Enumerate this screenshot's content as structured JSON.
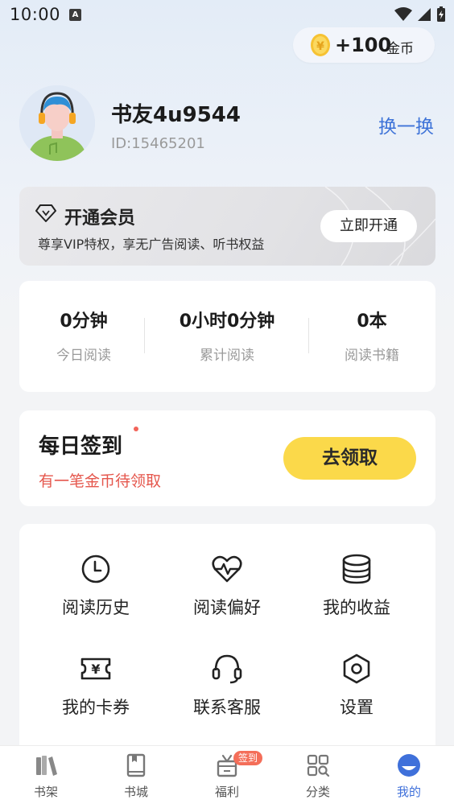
{
  "status_bar": {
    "time": "10:00",
    "notification_letter": "A"
  },
  "coins": {
    "amount": "+100",
    "label": "金币"
  },
  "profile": {
    "username": "书友4u9544",
    "user_id": "ID:15465201",
    "switch_label": "换一换"
  },
  "vip": {
    "title": "开通会员",
    "description": "尊享VIP特权，享无广告阅读、听书权益",
    "button_label": "立即开通"
  },
  "stats": [
    {
      "value": "0分钟",
      "label": "今日阅读"
    },
    {
      "value": "0小时0分钟",
      "label": "累计阅读"
    },
    {
      "value": "0本",
      "label": "阅读书籍"
    }
  ],
  "checkin": {
    "title": "每日签到",
    "subtitle": "有一笔金币待领取",
    "button_label": "去领取"
  },
  "menu": [
    {
      "icon": "clock-icon",
      "label": "阅读历史"
    },
    {
      "icon": "heart-pulse-icon",
      "label": "阅读偏好"
    },
    {
      "icon": "coin-stack-icon",
      "label": "我的收益"
    },
    {
      "icon": "ticket-icon",
      "label": "我的卡券"
    },
    {
      "icon": "headset-icon",
      "label": "联系客服"
    },
    {
      "icon": "settings-hexagon-icon",
      "label": "设置"
    }
  ],
  "bottom_nav": {
    "items": [
      {
        "icon": "bookshelf-icon",
        "label": "书架"
      },
      {
        "icon": "book-icon",
        "label": "书城"
      },
      {
        "icon": "gift-icon",
        "label": "福利",
        "badge": "签到"
      },
      {
        "icon": "category-grid-icon",
        "label": "分类"
      },
      {
        "icon": "profile-icon",
        "label": "我的"
      }
    ],
    "active_color": "#3f70da"
  },
  "colors": {
    "accent_blue": "#3e73d8",
    "checkin_yellow": "#fbd94a",
    "alert_red": "#e5574d"
  }
}
